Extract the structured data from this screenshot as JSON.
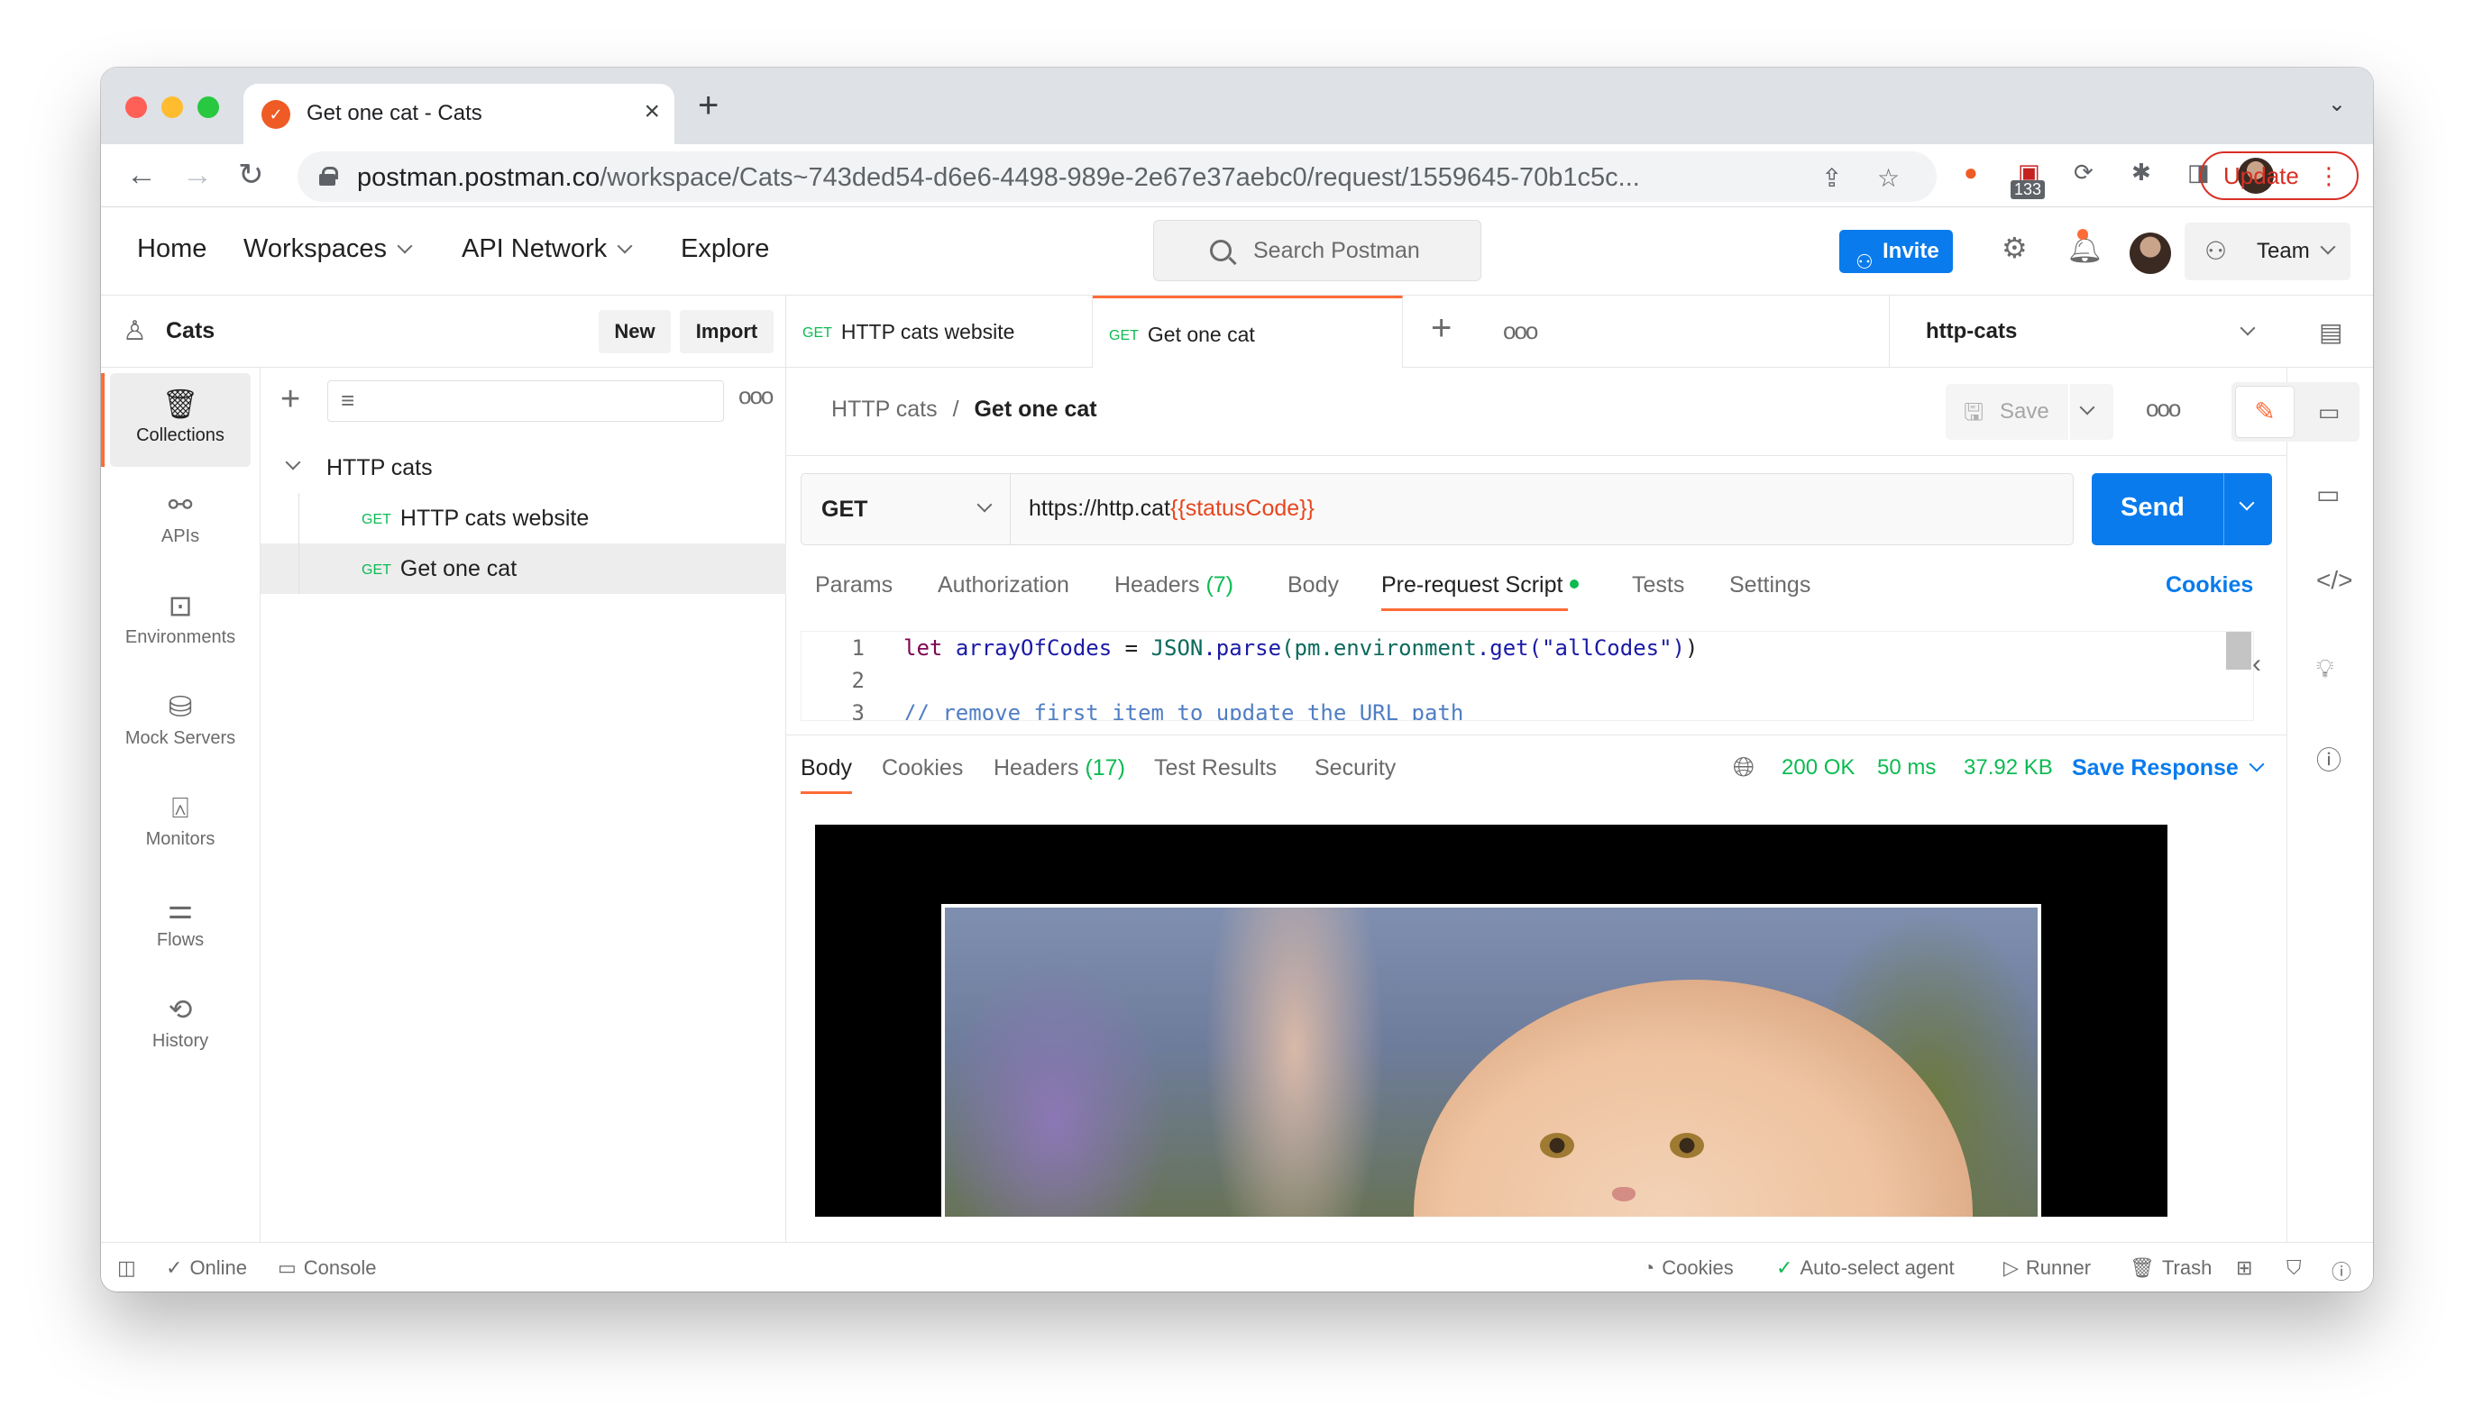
{
  "browser": {
    "tab_title": "Get one cat - Cats",
    "new_tab": "+",
    "close": "×",
    "url_host": "postman.postman.co",
    "url_path": "/workspace/Cats~743ded54-d6e6-4498-989e-2e67e37aebc0/request/1559645-70b1c5c...",
    "extension_badge": "133",
    "update_label": "Update"
  },
  "header": {
    "nav": [
      "Home",
      "Workspaces",
      "API Network",
      "Explore"
    ],
    "search_placeholder": "Search Postman",
    "invite_label": "Invite",
    "team_label": "Team"
  },
  "workspace": {
    "name": "Cats",
    "new_label": "New",
    "import_label": "Import"
  },
  "sidebar": {
    "items": [
      {
        "label": "Collections",
        "icon": "collections-icon",
        "active": true
      },
      {
        "label": "APIs",
        "icon": "apis-icon"
      },
      {
        "label": "Environments",
        "icon": "environments-icon"
      },
      {
        "label": "Mock Servers",
        "icon": "mock-servers-icon"
      },
      {
        "label": "Monitors",
        "icon": "monitors-icon"
      },
      {
        "label": "Flows",
        "icon": "flows-icon"
      },
      {
        "label": "History",
        "icon": "history-icon"
      }
    ]
  },
  "tree": {
    "collection": "HTTP cats",
    "requests": [
      {
        "method": "GET",
        "name": "HTTP cats website"
      },
      {
        "method": "GET",
        "name": "Get one cat",
        "selected": true
      }
    ]
  },
  "tabs": [
    {
      "method": "GET",
      "name": "HTTP cats website"
    },
    {
      "method": "GET",
      "name": "Get one cat",
      "active": true
    }
  ],
  "environment": "http-cats",
  "request": {
    "breadcrumb_parent": "HTTP cats",
    "breadcrumb_sep": "/",
    "breadcrumb_current": "Get one cat",
    "save_label": "Save",
    "method": "GET",
    "url_base": "https://http.cat",
    "url_var": "{{statusCode}}",
    "send_label": "Send",
    "tabs": [
      "Params",
      "Authorization",
      "Headers",
      "Body",
      "Pre-request Script",
      "Tests",
      "Settings"
    ],
    "headers_count": "(7)",
    "cookies_label": "Cookies"
  },
  "editor": {
    "lines": [
      "1",
      "2",
      "3"
    ],
    "line1_kw": "let",
    "line1_var": "arrayOfCodes",
    "line1_eq": "=",
    "line1_obj": "JSON",
    "line1_parse": ".parse",
    "line1_env": "(pm.environment",
    "line1_get": ".get",
    "line1_str": "(\"allCodes\")",
    "line1_end": ")",
    "line3": "// remove first item to update the URL path"
  },
  "response": {
    "tabs": [
      "Body",
      "Cookies",
      "Headers",
      "Test Results",
      "Security"
    ],
    "headers_count": "(17)",
    "status": "200 OK",
    "time": "50 ms",
    "size": "37.92 KB",
    "save_label": "Save Response"
  },
  "statusbar": {
    "online": "Online",
    "console": "Console",
    "cookies": "Cookies",
    "agent": "Auto-select agent",
    "runner": "Runner",
    "trash": "Trash"
  },
  "colors": {
    "accent": "#ff6c37",
    "primary": "#097bed",
    "success": "#0cbb52"
  }
}
